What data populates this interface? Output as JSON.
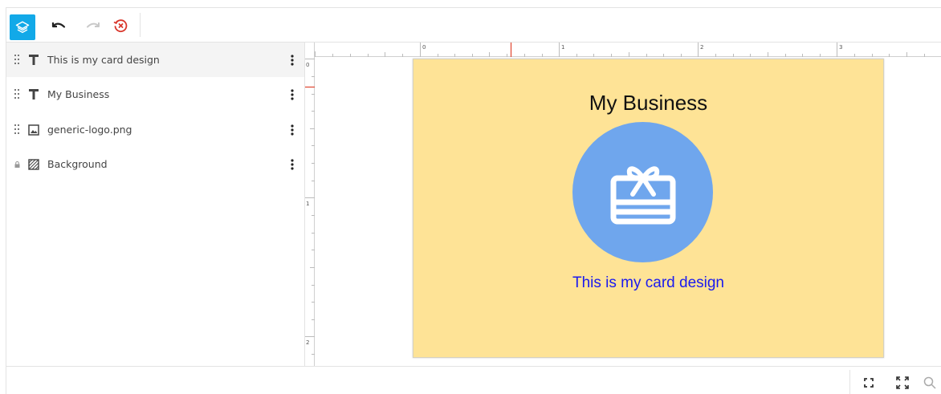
{
  "toolbar": {
    "layers_icon": "layers-icon",
    "undo_icon": "undo-icon",
    "redo_icon": "redo-icon",
    "reset_icon": "history-reset-icon",
    "accent_color": "#12a9e8",
    "reset_color": "#d9362b"
  },
  "layers": [
    {
      "name": "This is my card design",
      "type": "text",
      "locked": false,
      "active": true
    },
    {
      "name": "My Business",
      "type": "text",
      "locked": false,
      "active": false
    },
    {
      "name": "generic-logo.png",
      "type": "image",
      "locked": false,
      "active": false
    },
    {
      "name": "Background",
      "type": "background",
      "locked": true,
      "active": false
    }
  ],
  "rulers": {
    "top_labels": [
      "0",
      "1",
      "2",
      "3"
    ],
    "left_labels": [
      "0",
      "1",
      "2"
    ]
  },
  "card": {
    "title": "My Business",
    "subtitle": "This is my card design",
    "background_color": "#fee396",
    "logo_color": "#6fa6ed",
    "title_color": "#111111",
    "subtitle_color": "#1a1aef",
    "logo_icon": "gift-card-icon"
  },
  "bottombar": {
    "fit_icon": "fit-screen-icon",
    "fullscreen_icon": "fullscreen-icon",
    "zoom_icon": "zoom-icon"
  }
}
